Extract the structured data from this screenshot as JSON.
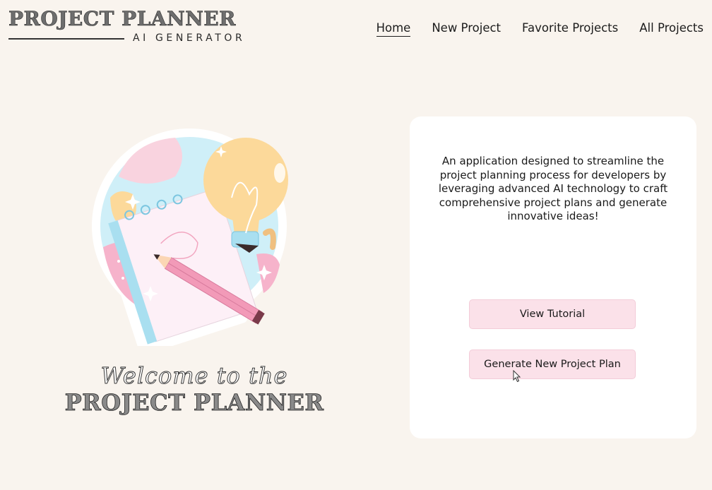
{
  "header": {
    "logo_title": "PROJECT PLANNER",
    "logo_subtitle": "AI GENERATOR",
    "nav": [
      {
        "label": "Home",
        "active": true
      },
      {
        "label": "New Project",
        "active": false
      },
      {
        "label": "Favorite Projects",
        "active": false
      },
      {
        "label": "All Projects",
        "active": false
      }
    ]
  },
  "hero": {
    "illustration_icon": "notebook-lightbulb-pencil-illustration",
    "welcome_script": "Welcome to the",
    "welcome_title": "PROJECT PLANNER"
  },
  "card": {
    "description": "An application designed to streamline the project planning process for developers by leveraging advanced AI technology to craft comprehensive project plans and generate innovative ideas!",
    "buttons": {
      "tutorial": "View Tutorial",
      "generate": "Generate New Project Plan"
    }
  },
  "colors": {
    "background": "#f9f4ee",
    "card": "#ffffff",
    "button": "#fbe1e9",
    "accent_pink": "#f4a7c0",
    "accent_blue": "#a9dff0",
    "accent_yellow": "#fcd99a"
  }
}
